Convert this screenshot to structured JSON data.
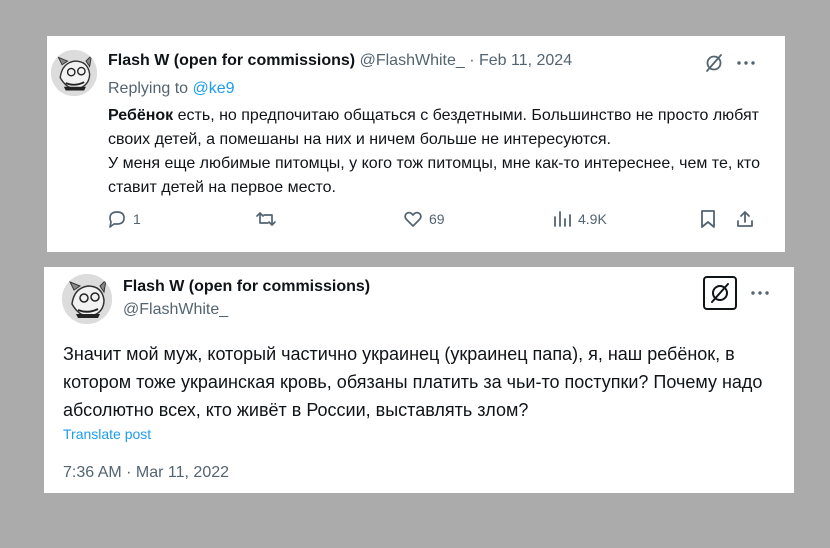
{
  "tweet1": {
    "display_name": "Flash W (open for commissions)",
    "handle": "@FlashWhite_",
    "separator": " · ",
    "date": "Feb 11, 2024",
    "replying_prefix": "Replying to ",
    "replying_to": "@ke9",
    "body_bold": "Ребёнок",
    "body_line1": " есть, но предпочитаю общаться с бездетными. Большинство не просто любят своих детей, а помешаны на них и ничем больше не интересуются.",
    "body_line2": "У меня еще любимые питомцы, у кого тож питомцы, мне как-то интереснее, чем те, кто ставит детей на первое место.",
    "actions": {
      "replies": "1",
      "retweets": "",
      "likes": "69",
      "views": "4.9K"
    },
    "icons": [
      "grok-icon",
      "more-icon",
      "reply-icon",
      "retweet-icon",
      "like-icon",
      "views-icon",
      "bookmark-icon",
      "share-icon"
    ]
  },
  "tweet2": {
    "display_name": "Flash W (open for commissions)",
    "handle": "@FlashWhite_",
    "body": "Значит мой муж, который частично украинец (украинец папа), я, наш ребёнок, в котором тоже украинская кровь, обязаны платить за чьи-то поступки? Почему надо абсолютно всех, кто живёт в России, выставлять злом?",
    "translate_label": "Translate post",
    "timestamp": "7:36 AM · Mar 11, 2022",
    "icons": [
      "grok-icon",
      "more-icon"
    ]
  },
  "colors": {
    "background": "#ababab",
    "text": "#0f1419",
    "secondary": "#536471",
    "link": "#1d9bf0"
  }
}
